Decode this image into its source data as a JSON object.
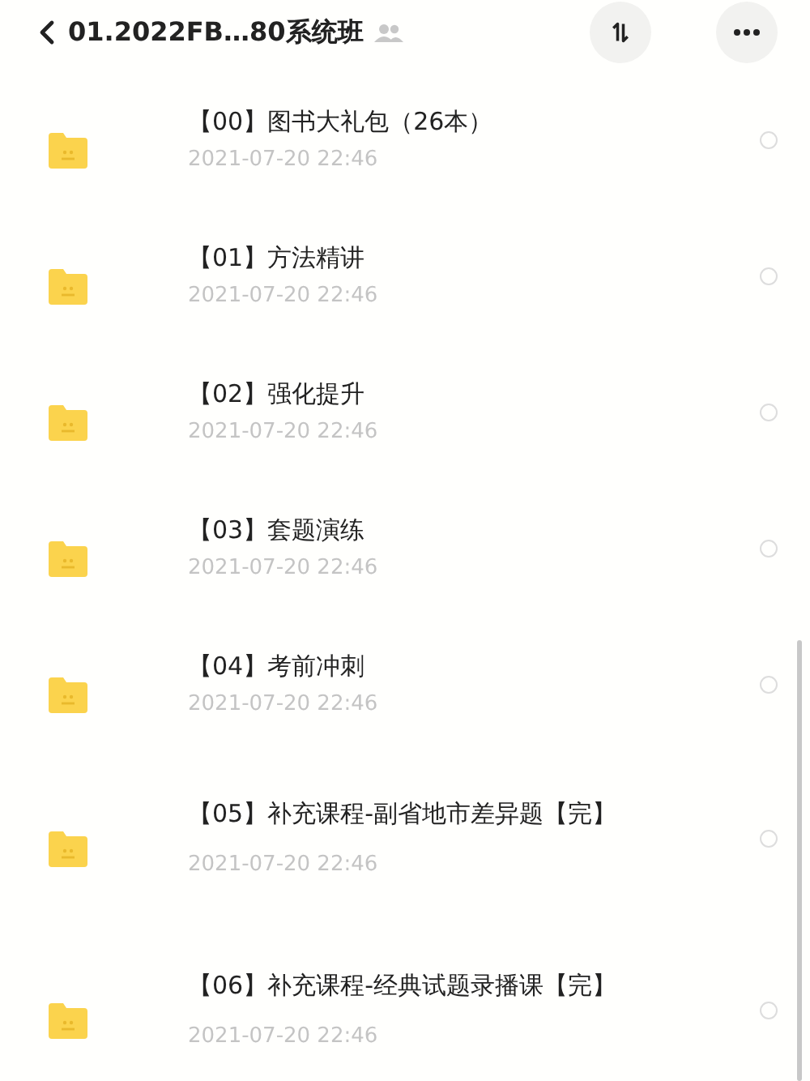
{
  "header": {
    "title": "01.2022FB…80系统班"
  },
  "items": [
    {
      "name": "【00】图书大礼包（26本）",
      "date": "2021-07-20 22:46",
      "selected": false
    },
    {
      "name": "【01】方法精讲",
      "date": "2021-07-20 22:46",
      "selected": false
    },
    {
      "name": "【02】强化提升",
      "date": "2021-07-20 22:46",
      "selected": false
    },
    {
      "name": "【03】套题演练",
      "date": "2021-07-20 22:46",
      "selected": false
    },
    {
      "name": "【04】考前冲刺",
      "date": "2021-07-20 22:46",
      "selected": false
    },
    {
      "name": "【05】补充课程-副省地市差异题【完】",
      "date": "2021-07-20 22:46",
      "selected": false
    },
    {
      "name": "【06】补充课程-经典试题录播课【完】",
      "date": "2021-07-20 22:46",
      "selected": false
    }
  ]
}
